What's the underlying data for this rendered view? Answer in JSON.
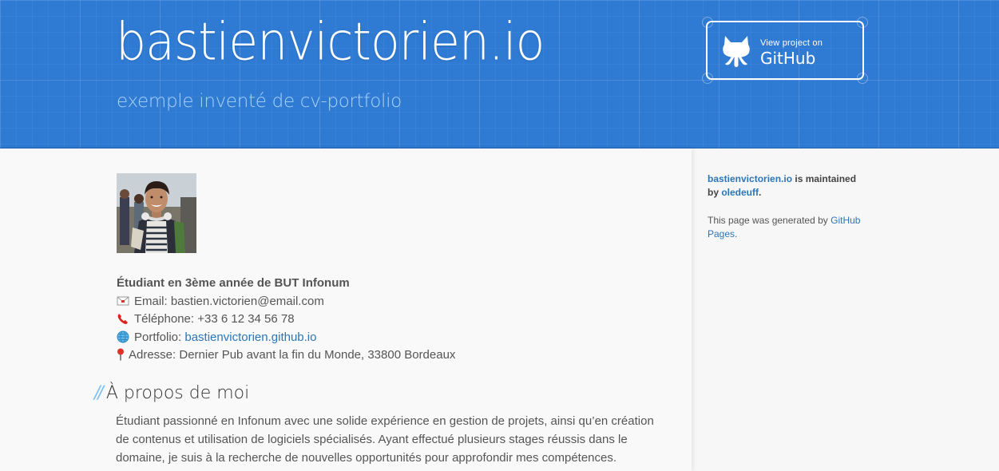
{
  "header": {
    "title": "bastienvictorien.io",
    "subtitle": "exemple inventé de cv-portfolio",
    "github_button": {
      "small": "View project on",
      "big": "GitHub",
      "icon": "github-octocat-icon"
    }
  },
  "profile": {
    "headline": "Étudiant en 3ème année de BUT Infonum",
    "email_label": "Email: bastien.victorien@email.com",
    "phone_label": "Téléphone: +33 6 12 34 56 78",
    "portfolio_prefix": "Portfolio: ",
    "portfolio_link": "bastienvictorien.github.io",
    "address_label": "Adresse: Dernier Pub avant la fin du Monde, 33800 Bordeaux",
    "icons": [
      "email-icon",
      "telephone-icon",
      "globe-icon",
      "pushpin-icon"
    ]
  },
  "about": {
    "title": "À propos de moi",
    "text": "Étudiant passionné en Infonum avec une solide expérience en gestion de projets, ainsi qu’en création de contenus et utilisation de logiciels spécialisés. Ayant effectué plusieurs stages réussis dans le domaine, je suis à la recherche de nouvelles opportunités pour approfondir mes compétences."
  },
  "sidebar": {
    "maintained_link": "bastienvictorien.io",
    "maintained_text": " is maintained by ",
    "maintainer": "oledeuff",
    "maintained_end": ".",
    "generated_text": "This page was generated by ",
    "generated_link": "GitHub Pages",
    "generated_end": "."
  },
  "colors": {
    "header": "#2f7ad3",
    "subtitle": "#a9d4fb",
    "link": "#2c76b8",
    "background": "#f7f7f7"
  }
}
